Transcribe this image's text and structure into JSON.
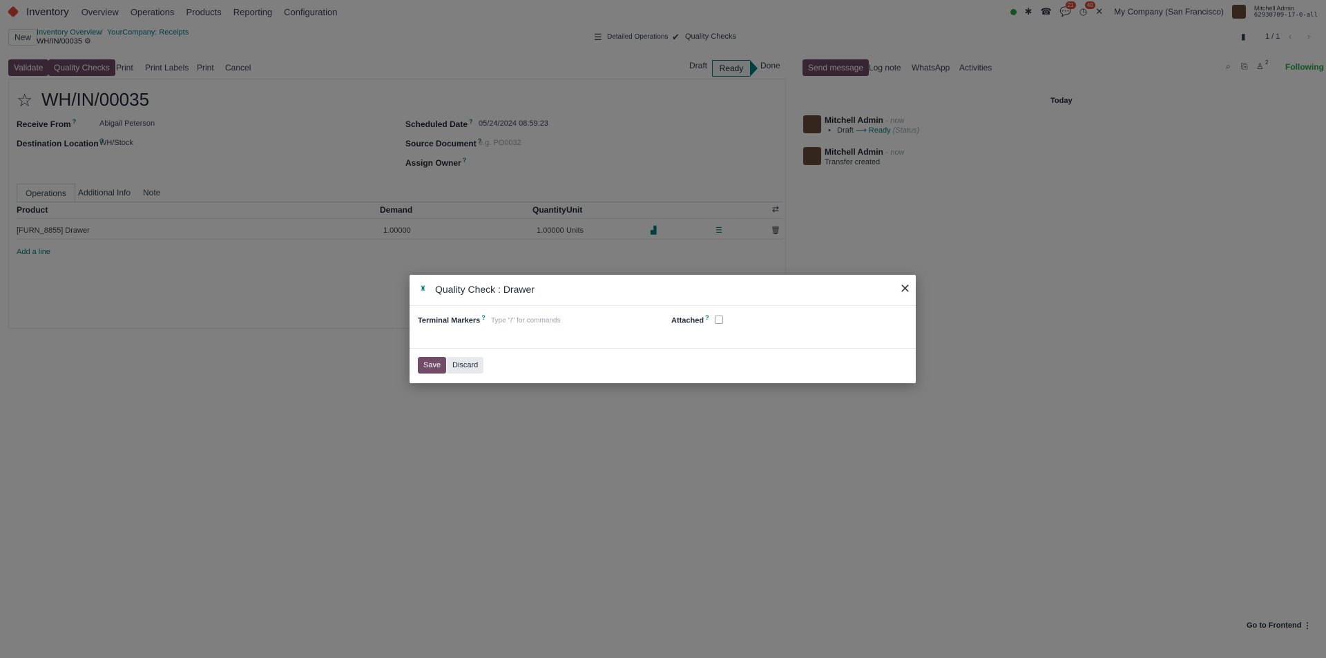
{
  "colors": {
    "accent": "#714b67",
    "link": "#017e84",
    "danger_badge": "#e14a36"
  },
  "topnav": {
    "app_name": "Inventory",
    "menu": [
      "Overview",
      "Operations",
      "Products",
      "Reporting",
      "Configuration"
    ],
    "badges": {
      "messages": "21",
      "activities": "40"
    },
    "company": "My Company (San Francisco)",
    "user_name": "Mitchell Admin",
    "db_name": "62930709-17-0-all"
  },
  "control": {
    "new_label": "New",
    "breadcrumb_1": "Inventory Overview",
    "breadcrumb_2": "YourCompany: Receipts",
    "record_name": "WH/IN/00035",
    "detailed_ops": "Detailed Operations",
    "quality_checks_smart": "Quality Checks",
    "pager": "1 / 1"
  },
  "actions": {
    "validate": "Validate",
    "quality_checks": "Quality Checks",
    "print": "Print",
    "print_labels": "Print Labels",
    "print2": "Print",
    "cancel": "Cancel"
  },
  "status": {
    "draft": "Draft",
    "ready": "Ready",
    "done": "Done"
  },
  "form": {
    "title": "WH/IN/00035",
    "receive_from_label": "Receive From",
    "receive_from_value": "Abigail Peterson",
    "dest_label": "Destination Location",
    "dest_value": "WH/Stock",
    "scheduled_label": "Scheduled Date",
    "scheduled_value": "05/24/2024 08:59:23",
    "source_label": "Source Document",
    "source_placeholder": "e.g. PO0032",
    "owner_label": "Assign Owner",
    "tabs": [
      "Operations",
      "Additional Info",
      "Note"
    ],
    "columns": {
      "product": "Product",
      "demand": "Demand",
      "quantity": "Quantity",
      "unit": "Unit"
    },
    "row": {
      "product": "[FURN_8855] Drawer",
      "demand": "1.00000",
      "quantity": "1.00000",
      "unit": "Units"
    },
    "add_line": "Add a line"
  },
  "chatter": {
    "send_message": "Send message",
    "log_note": "Log note",
    "whatsapp": "WhatsApp",
    "activities": "Activities",
    "followers_count": "2",
    "following": "Following",
    "day": "Today",
    "messages": [
      {
        "author": "Mitchell Admin",
        "time": "- now",
        "from": "Draft",
        "to": "Ready",
        "field": "(Status)"
      },
      {
        "author": "Mitchell Admin",
        "time": "- now",
        "body": "Transfer created"
      }
    ]
  },
  "modal": {
    "title": "Quality Check : Drawer",
    "field_label": "Terminal Markers",
    "field_placeholder": "Type \"/\" for commands",
    "attached_label": "Attached",
    "save": "Save",
    "discard": "Discard"
  },
  "footer": {
    "go_frontend": "Go to Frontend"
  }
}
